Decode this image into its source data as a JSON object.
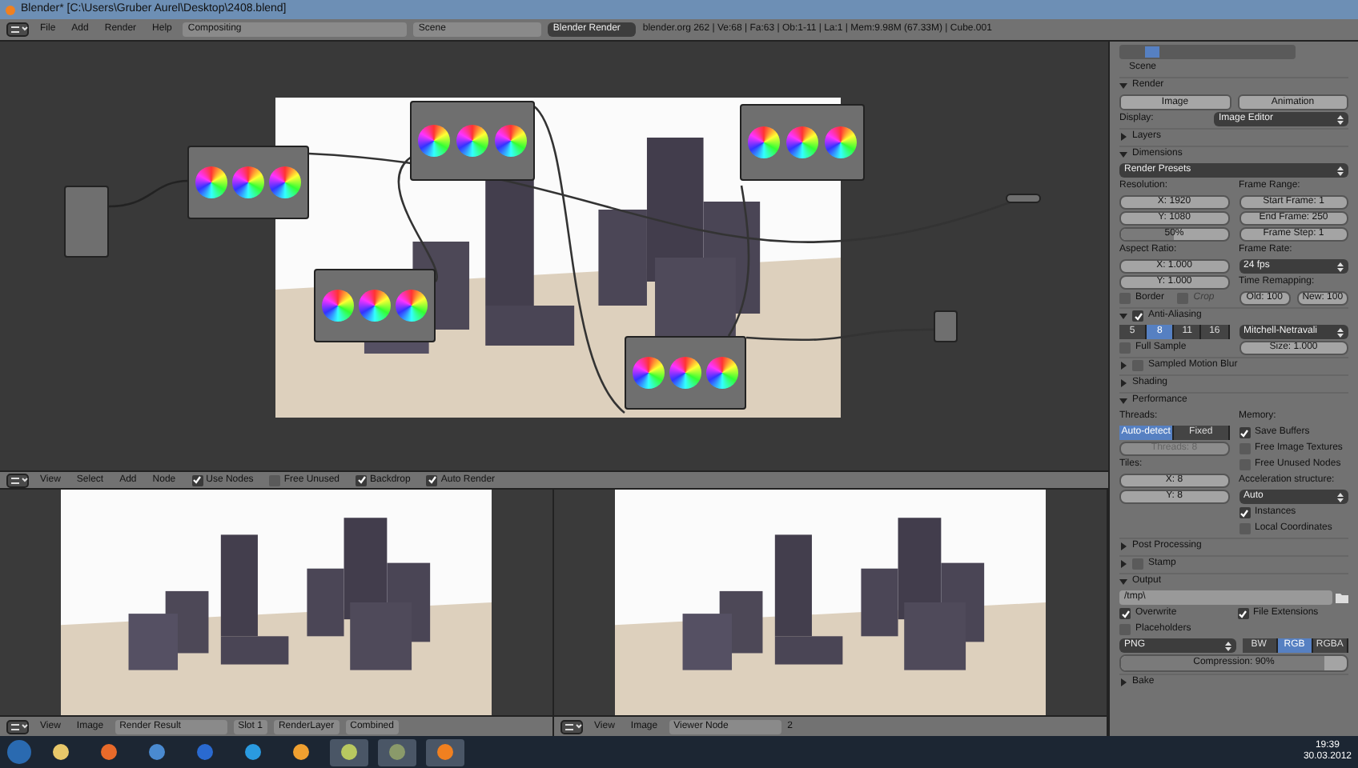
{
  "window": {
    "title": "Blender* [C:\\Users\\Gruber Aurel\\Desktop\\2408.blend]"
  },
  "header": {
    "menus": [
      "File",
      "Add",
      "Render",
      "Help"
    ],
    "layout": "Compositing",
    "scene": "Scene",
    "engine": "Blender Render",
    "info": "blender.org 262 | Ve:68 | Fa:63 | Ob:1-11 | La:1 | Mem:9.98M (67.33M) | Cube.001"
  },
  "node_editor": {
    "menus": [
      "View",
      "Select",
      "Add",
      "Node"
    ],
    "toggles": [
      {
        "label": "Use Nodes",
        "checked": true
      },
      {
        "label": "Free Unused",
        "checked": false
      },
      {
        "label": "Backdrop",
        "checked": true
      },
      {
        "label": "Auto Render",
        "checked": true
      }
    ]
  },
  "image_editors": [
    {
      "menus": [
        "View",
        "Image"
      ],
      "image": "Render Result",
      "selectors": [
        "Slot 1",
        "RenderLayer",
        "Combined"
      ]
    },
    {
      "menus": [
        "View",
        "Image"
      ],
      "image": "Viewer Node",
      "users": "2"
    }
  ],
  "properties": {
    "breadcrumb": "Scene",
    "sections": [
      {
        "title": "Render",
        "expanded": true,
        "rows": [
          {
            "kind": "row",
            "items": [
              {
                "kind": "button",
                "label": "Image"
              },
              {
                "kind": "button",
                "label": "Animation"
              }
            ]
          },
          {
            "kind": "labeled",
            "label": "Display:",
            "value": "Image Editor"
          }
        ]
      },
      {
        "title": "Layers",
        "expanded": false
      },
      {
        "title": "Dimensions",
        "expanded": true,
        "rows": [
          {
            "kind": "dropdown",
            "value": "Render Presets"
          },
          {
            "kind": "cols",
            "left": [
              {
                "kind": "label",
                "text": "Resolution:"
              },
              {
                "kind": "number",
                "text": "X: 1920"
              },
              {
                "kind": "number",
                "text": "Y: 1080"
              },
              {
                "kind": "number",
                "text": "50%",
                "level": 0.5
              }
            ],
            "right": [
              {
                "kind": "label",
                "text": "Frame Range:"
              },
              {
                "kind": "number",
                "text": "Start Frame: 1"
              },
              {
                "kind": "number",
                "text": "End Frame: 250"
              },
              {
                "kind": "number",
                "text": "Frame Step: 1"
              }
            ]
          },
          {
            "kind": "cols",
            "left": [
              {
                "kind": "label",
                "text": "Aspect Ratio:"
              },
              {
                "kind": "number",
                "text": "X: 1.000"
              },
              {
                "kind": "number",
                "text": "Y: 1.000"
              },
              {
                "kind": "row",
                "items": [
                  {
                    "kind": "checkbox",
                    "label": "Border",
                    "checked": false,
                    "disabled": false
                  },
                  {
                    "kind": "checkbox",
                    "label": "Crop",
                    "checked": false,
                    "disabled": true
                  }
                ]
              }
            ],
            "right": [
              {
                "kind": "label",
                "text": "Frame Rate:"
              },
              {
                "kind": "dropdown",
                "value": "24 fps"
              },
              {
                "kind": "label",
                "text": "Time Remapping:"
              },
              {
                "kind": "row",
                "items": [
                  {
                    "kind": "number",
                    "text": "Old: 100"
                  },
                  {
                    "kind": "number",
                    "text": "New: 100"
                  }
                ]
              }
            ]
          }
        ]
      },
      {
        "title": "Anti-Aliasing",
        "expanded": true,
        "checkbox": true,
        "rows": [
          {
            "kind": "cols",
            "left": [
              {
                "kind": "segmented",
                "items": [
                  {
                    "label": "5",
                    "selected": false
                  },
                  {
                    "label": "8",
                    "selected": true
                  },
                  {
                    "label": "11",
                    "selected": false
                  },
                  {
                    "label": "16",
                    "selected": false
                  }
                ]
              },
              {
                "kind": "checkbox",
                "label": "Full Sample",
                "checked": false
              }
            ],
            "right": [
              {
                "kind": "dropdown",
                "value": "Mitchell-Netravali"
              },
              {
                "kind": "number",
                "text": "Size: 1.000"
              }
            ]
          }
        ]
      },
      {
        "title": "Sampled Motion Blur",
        "expanded": false,
        "checkbox": false
      },
      {
        "title": "Shading",
        "expanded": false
      },
      {
        "title": "Performance",
        "expanded": true,
        "rows": [
          {
            "kind": "cols",
            "left": [
              {
                "kind": "label",
                "text": "Threads:"
              },
              {
                "kind": "segmented",
                "items": [
                  {
                    "label": "Auto-detect",
                    "selected": true
                  },
                  {
                    "label": "Fixed",
                    "selected": false
                  }
                ]
              },
              {
                "kind": "number",
                "text": "Threads: 8",
                "disabled": true
              },
              {
                "kind": "label",
                "text": "Tiles:"
              },
              {
                "kind": "number",
                "text": "X: 8"
              },
              {
                "kind": "number",
                "text": "Y: 8"
              }
            ],
            "right": [
              {
                "kind": "label",
                "text": "Memory:"
              },
              {
                "kind": "checkbox",
                "label": "Save Buffers",
                "checked": true
              },
              {
                "kind": "checkbox",
                "label": "Free Image Textures",
                "checked": false
              },
              {
                "kind": "checkbox",
                "label": "Free Unused Nodes",
                "checked": false
              },
              {
                "kind": "label",
                "text": "Acceleration structure:"
              },
              {
                "kind": "dropdown",
                "value": "Auto"
              },
              {
                "kind": "checkbox",
                "label": "Instances",
                "checked": true
              },
              {
                "kind": "checkbox",
                "label": "Local Coordinates",
                "checked": false
              }
            ]
          }
        ]
      },
      {
        "title": "Post Processing",
        "expanded": false
      },
      {
        "title": "Stamp",
        "expanded": false,
        "checkbox": false
      },
      {
        "title": "Output",
        "expanded": true,
        "rows": [
          {
            "kind": "path",
            "value": "/tmp\\"
          },
          {
            "kind": "row",
            "items": [
              {
                "kind": "checkbox",
                "label": "Overwrite",
                "checked": true
              },
              {
                "kind": "checkbox",
                "label": "File Extensions",
                "checked": true
              }
            ]
          },
          {
            "kind": "checkbox",
            "label": "Placeholders",
            "checked": false
          },
          {
            "kind": "row",
            "items": [
              {
                "kind": "dropdown",
                "value": "PNG"
              },
              {
                "kind": "segmented",
                "items": [
                  {
                    "label": "BW",
                    "selected": false
                  },
                  {
                    "label": "RGB",
                    "selected": true
                  },
                  {
                    "label": "RGBA",
                    "selected": false
                  }
                ]
              }
            ]
          },
          {
            "kind": "number",
            "text": "Compression: 90%",
            "level": 0.9
          }
        ]
      },
      {
        "title": "Bake",
        "expanded": false
      }
    ]
  },
  "taskbar": {
    "apps": [
      {
        "kind": "folder",
        "selected": false
      },
      {
        "kind": "browser",
        "selected": false
      },
      {
        "kind": "mail",
        "selected": false
      },
      {
        "kind": "bird",
        "selected": false
      },
      {
        "kind": "play",
        "selected": false
      },
      {
        "kind": "media",
        "selected": false
      },
      {
        "kind": "notes",
        "selected": true
      },
      {
        "kind": "app",
        "selected": true
      },
      {
        "kind": "blender",
        "selected": true
      }
    ],
    "time": "19:39",
    "date": "30.03.2012"
  }
}
